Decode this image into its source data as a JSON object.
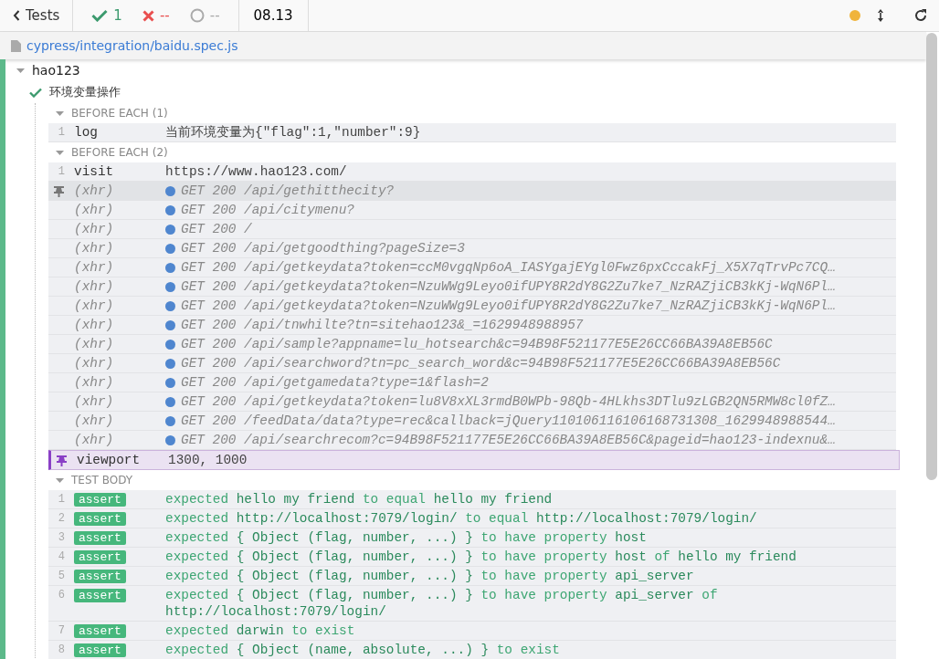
{
  "header": {
    "back_label": "Tests",
    "passed": "1",
    "failed": "--",
    "pending": "--",
    "duration": "08.13"
  },
  "file_path": "cypress/integration/baidu.spec.js",
  "suite": {
    "title": "hao123",
    "expanded": true,
    "test": {
      "title": "环境变量操作",
      "passed": true,
      "hooks": [
        {
          "title": "BEFORE EACH (1)",
          "expanded": true,
          "commands": [
            {
              "kind": "log",
              "number": "1",
              "name": "log",
              "message": "当前环境变量为{\"flag\":1,\"number\":9}",
              "pinned": false,
              "highlighted": false
            }
          ]
        },
        {
          "title": "BEFORE EACH (2)",
          "expanded": true,
          "commands": [
            {
              "kind": "command",
              "number": "1",
              "name": "visit",
              "message": "https://www.hao123.com/",
              "pinned": false,
              "highlighted": false
            },
            {
              "kind": "xhr",
              "name": "(xhr)",
              "message": "GET 200 /api/gethitthecity?",
              "pinned": false,
              "highlighted": true
            },
            {
              "kind": "xhr",
              "name": "(xhr)",
              "message": "GET 200 /api/citymenu?",
              "pinned": false,
              "highlighted": false
            },
            {
              "kind": "xhr",
              "name": "(xhr)",
              "message": "GET 200 /",
              "pinned": false,
              "highlighted": false
            },
            {
              "kind": "xhr",
              "name": "(xhr)",
              "message": "GET 200 /api/getgoodthing?pageSize=3",
              "pinned": false,
              "highlighted": false
            },
            {
              "kind": "xhr",
              "name": "(xhr)",
              "message": "GET 200 /api/getkeydata?token=ccM0vgqNp6oA_IASYgajEYgl0Fwz6pxCccakFj_X5X7qTrvPc7CQ…",
              "pinned": false,
              "highlighted": false
            },
            {
              "kind": "xhr",
              "name": "(xhr)",
              "message": "GET 200 /api/getkeydata?token=NzuWWg9Leyo0ifUPY8R2dY8G2Zu7ke7_NzRAZjiCB3kKj-WqN6Pl…",
              "pinned": false,
              "highlighted": false
            },
            {
              "kind": "xhr",
              "name": "(xhr)",
              "message": "GET 200 /api/getkeydata?token=NzuWWg9Leyo0ifUPY8R2dY8G2Zu7ke7_NzRAZjiCB3kKj-WqN6Pl…",
              "pinned": false,
              "highlighted": false
            },
            {
              "kind": "xhr",
              "name": "(xhr)",
              "message": "GET 200 /api/tnwhilte?tn=sitehao123&_=1629948988957",
              "pinned": false,
              "highlighted": false
            },
            {
              "kind": "xhr",
              "name": "(xhr)",
              "message": "GET 200 /api/sample?appname=lu_hotsearch&c=94B98F521177E5E26CC66BA39A8EB56C",
              "pinned": false,
              "highlighted": false
            },
            {
              "kind": "xhr",
              "name": "(xhr)",
              "message": "GET 200 /api/searchword?tn=pc_search_word&c=94B98F521177E5E26CC66BA39A8EB56C",
              "pinned": false,
              "highlighted": false
            },
            {
              "kind": "xhr",
              "name": "(xhr)",
              "message": "GET 200 /api/getgamedata?type=1&flash=2",
              "pinned": false,
              "highlighted": false
            },
            {
              "kind": "xhr",
              "name": "(xhr)",
              "message": "GET 200 /api/getkeydata?token=lu8V8xXL3rmdB0WPb-98Qb-4HLkhs3DTlu9zLGB2QN5RMW8cl0fZ…",
              "pinned": false,
              "highlighted": false
            },
            {
              "kind": "xhr",
              "name": "(xhr)",
              "message": "GET 200 /feedData/data?type=rec&callback=jQuery110106116106168731308_1629948988544…",
              "pinned": false,
              "highlighted": false
            },
            {
              "kind": "xhr",
              "name": "(xhr)",
              "message": "GET 200 /api/searchrecom?c=94B98F521177E5E26CC66BA39A8EB56C&pageid=hao123-indexnu&…",
              "pinned": false,
              "highlighted": false
            },
            {
              "kind": "command",
              "name": "viewport",
              "message": "1300, 1000",
              "pinned": true,
              "highlighted": false
            }
          ]
        },
        {
          "title": "TEST BODY",
          "expanded": true,
          "commands": [
            {
              "kind": "assert",
              "number": "1",
              "name": "assert",
              "message": "expected **hello my friend** to equal **hello my friend**",
              "pinned": false,
              "highlighted": false
            },
            {
              "kind": "assert",
              "number": "2",
              "name": "assert",
              "message": "expected **http://localhost:7079/login/** to equal **http://localhost:7079/login/**",
              "pinned": false,
              "highlighted": false
            },
            {
              "kind": "assert",
              "number": "3",
              "name": "assert",
              "message": "expected **{ Object (flag, number, ...) }** to have property **host**",
              "pinned": false,
              "highlighted": false
            },
            {
              "kind": "assert",
              "number": "4",
              "name": "assert",
              "message": "expected **{ Object (flag, number, ...) }** to have property **host** of **hello my friend**",
              "pinned": false,
              "highlighted": false
            },
            {
              "kind": "assert",
              "number": "5",
              "name": "assert",
              "message": "expected **{ Object (flag, number, ...) }** to have property **api_server**",
              "pinned": false,
              "highlighted": false
            },
            {
              "kind": "assert",
              "number": "6",
              "name": "assert",
              "message": "expected **{ Object (flag, number, ...) }** to have property **api_server** of **http://localhost:7079/login/**",
              "pinned": false,
              "highlighted": false
            },
            {
              "kind": "assert",
              "number": "7",
              "name": "assert",
              "message": "expected **darwin** to exist",
              "pinned": false,
              "highlighted": false
            },
            {
              "kind": "assert",
              "number": "8",
              "name": "assert",
              "message": "expected **{ Object (name, absolute, ...) }** to exist",
              "pinned": false,
              "highlighted": false
            }
          ]
        }
      ]
    }
  }
}
